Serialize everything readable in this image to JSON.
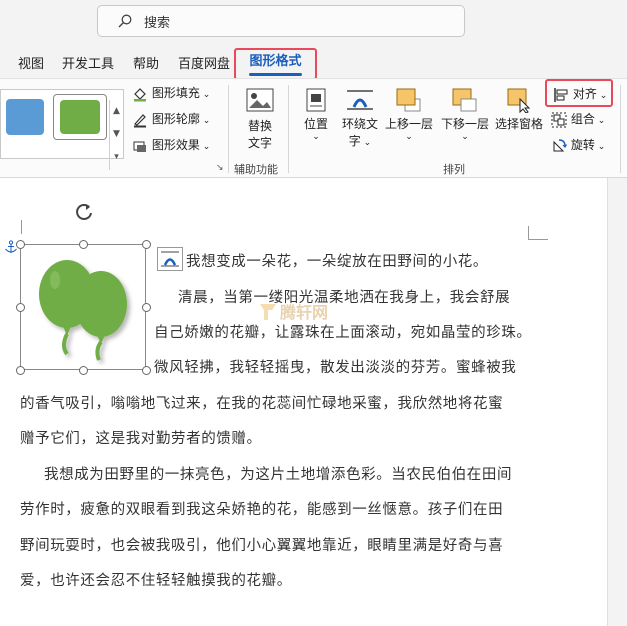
{
  "search": {
    "placeholder": "搜索"
  },
  "tabs": [
    "视图",
    "开发工具",
    "帮助",
    "百度网盘",
    "图形格式"
  ],
  "ribbon": {
    "styles": {
      "fill": "图形填充",
      "outline": "图形轮廓",
      "effects": "图形效果"
    },
    "accessibility": {
      "alt_text_line1": "替换",
      "alt_text_line2": "文字",
      "group_label": "辅助功能"
    },
    "arrange": {
      "position": "位置",
      "wrap_line1": "环绕文",
      "wrap_line2": "字",
      "bring_forward": "上移一层",
      "send_backward": "下移一层",
      "selection_pane": "选择窗格",
      "align": "对齐",
      "group": "组合",
      "rotate": "旋转",
      "group_label": "排列"
    },
    "colors": {
      "blue_swatch": "#5b9bd5",
      "green_swatch": "#70ad47",
      "highlight": "#e8495b",
      "accent": "#1b5fbd"
    }
  },
  "document": {
    "lines": [
      "我想变成一朵花，一朵绽放在田野间的小花。",
      "清晨，当第一缕阳光温柔地洒在我身上，我会舒展",
      "自己娇嫩的花瓣，让露珠在上面滚动，宛如晶莹的珍珠。",
      "微风轻拂，我轻轻摇曳，散发出淡淡的芬芳。蜜蜂被我",
      "的香气吸引，嗡嗡地飞过来，在我的花蕊间忙碌地采蜜，我欣然地将花蜜",
      "赠予它们，这是我对勤劳者的馈赠。",
      "我想成为田野里的一抹亮色，为这片土地增添色彩。当农民伯伯在田间",
      "劳作时，疲惫的双眼看到我这朵娇艳的花，能感到一丝惬意。孩子们在田",
      "野间玩耍时，也会被我吸引，他们小心翼翼地靠近，眼睛里满是好奇与喜",
      "爱，也许还会忍不住轻轻触摸我的花瓣。"
    ],
    "watermark": "腾轩网",
    "image_icon": "balloons-icon"
  }
}
